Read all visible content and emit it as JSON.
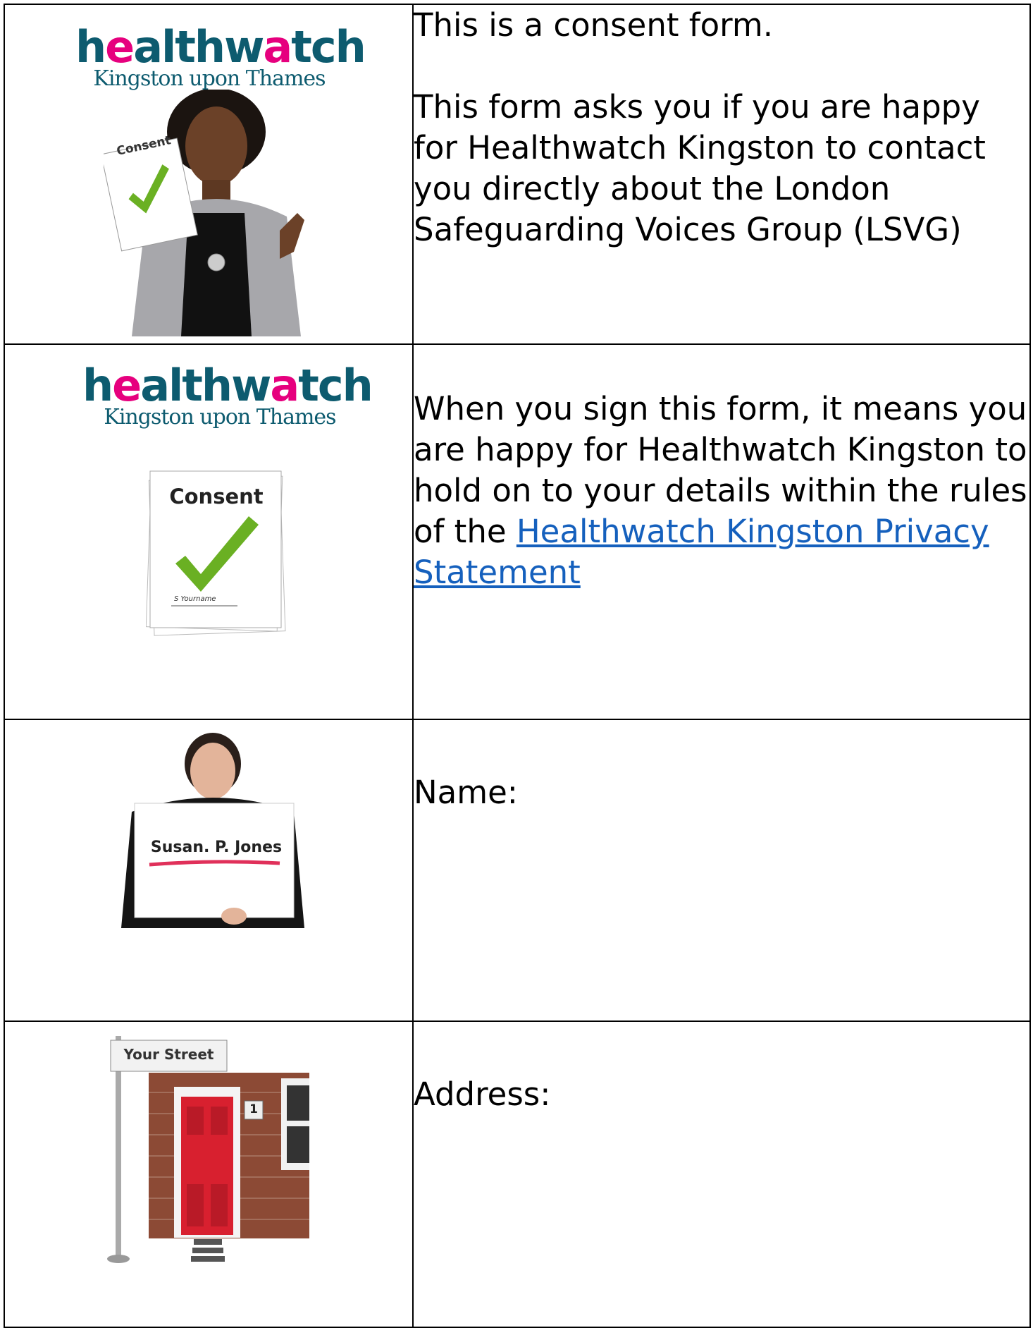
{
  "logo": {
    "main_before": "h",
    "main_accent": "e",
    "main_mid": "althw",
    "main_accent2": "a",
    "main_after": "tch",
    "sub": "Kingston upon Thames"
  },
  "colors": {
    "logo_teal": "#0d5b6f",
    "logo_pink": "#e6007e",
    "link": "#1560bd",
    "check_green": "#6ab023"
  },
  "rows": [
    {
      "paragraphs": [
        "This is a consent form.",
        "This form asks you if you are happy for Healthwatch Kingston to contact you directly about the London Safeguarding Voices Group (LSVG)"
      ],
      "image_label": "Consent"
    },
    {
      "text_before": "When you sign this form, it means you are happy for Healthwatch Kingston to hold on to your details within the rules of the ",
      "link_text": "Healthwatch Kingston Privacy Statement",
      "image_label": "Consent",
      "image_signature": "S Yourname"
    },
    {
      "label": "Name:",
      "sign_text": "Susan. P. Jones"
    },
    {
      "label": "Address:",
      "street_sign": "Your Street",
      "house_number": "1"
    }
  ]
}
